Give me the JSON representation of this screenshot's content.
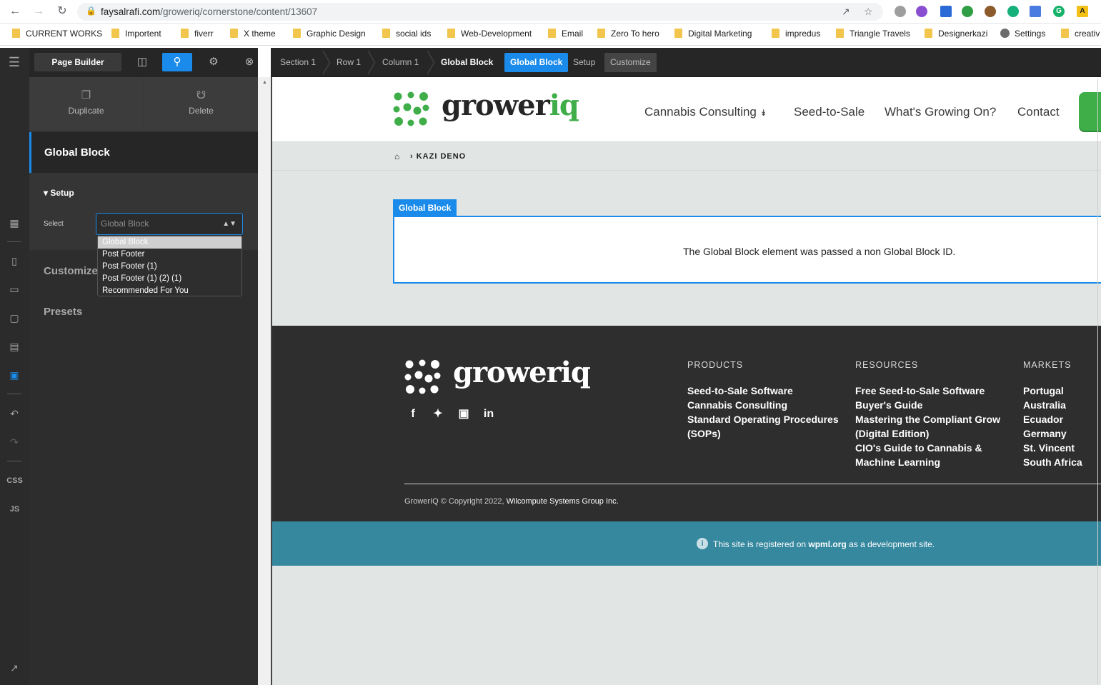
{
  "browser": {
    "url_domain": "faysalrafi.com",
    "url_path": "/groweriq/cornerstone/content/13607",
    "bookmarks": [
      "CURRENT WORKS",
      "Importent",
      "fiverr",
      "X theme",
      "Graphic Design",
      "social ids",
      "Web-Development",
      "Email",
      "Zero To hero",
      "Digital Marketing",
      "impredus",
      "Triangle Travels",
      "Designerkazi",
      "Settings",
      "creativ"
    ]
  },
  "rail": {
    "css_label": "CSS",
    "js_label": "JS"
  },
  "panel": {
    "page_builder_label": "Page Builder",
    "duplicate_label": "Duplicate",
    "delete_label": "Delete",
    "element_title": "Global Block",
    "setup_label": "Setup",
    "select_label": "Select",
    "select_value": "Global Block",
    "dropdown_options": [
      "Global Block",
      "Post Footer",
      "Post Footer (1)",
      "Post Footer (1) (2) (1)",
      "Recommended For You"
    ],
    "customize_label": "Customize",
    "presets_label": "Presets"
  },
  "breadcrumb_bar": {
    "items": [
      "Section 1",
      "Row 1",
      "Column 1",
      "Global Block"
    ],
    "active_pill": "Global Block",
    "setup_pill": "Setup",
    "customize_pill": "Customize"
  },
  "site": {
    "logo_word": "grower",
    "logo_accent": "iq",
    "nav": [
      "Cannabis Consulting",
      "Seed-to-Sale",
      "What's Growing On?",
      "Contact"
    ],
    "breadcrumb": "KAZI DENO",
    "global_block_tag": "Global Block",
    "global_block_message": "The Global Block element was passed a non Global Block ID.",
    "footer": {
      "products_title": "PRODUCTS",
      "products_links": [
        "Seed-to-Sale Software",
        "Cannabis Consulting",
        "Standard Operating Procedures",
        "(SOPs)"
      ],
      "resources_title": "RESOURCES",
      "resources_links": [
        "Free Seed-to-Sale Software",
        "Buyer's Guide",
        "Mastering the Compliant Grow",
        "(Digital Edition)",
        "CIO's Guide to Cannabis &",
        "Machine Learning"
      ],
      "markets_title": "MARKETS",
      "markets_links": [
        "Portugal",
        "Australia",
        "Ecuador",
        "Germany",
        "St. Vincent",
        "South Africa"
      ],
      "copyright": "GrowerIQ © Copyright 2022, ",
      "company": "Wilcompute Systems Group Inc."
    },
    "wpml": {
      "before": "This site is registered on ",
      "link": "wpml.org",
      "after": " as a development site."
    },
    "colors": {
      "brand_green": "#3fae49",
      "builder_blue": "#1a8bea",
      "wpml_bar": "#36889f"
    }
  }
}
